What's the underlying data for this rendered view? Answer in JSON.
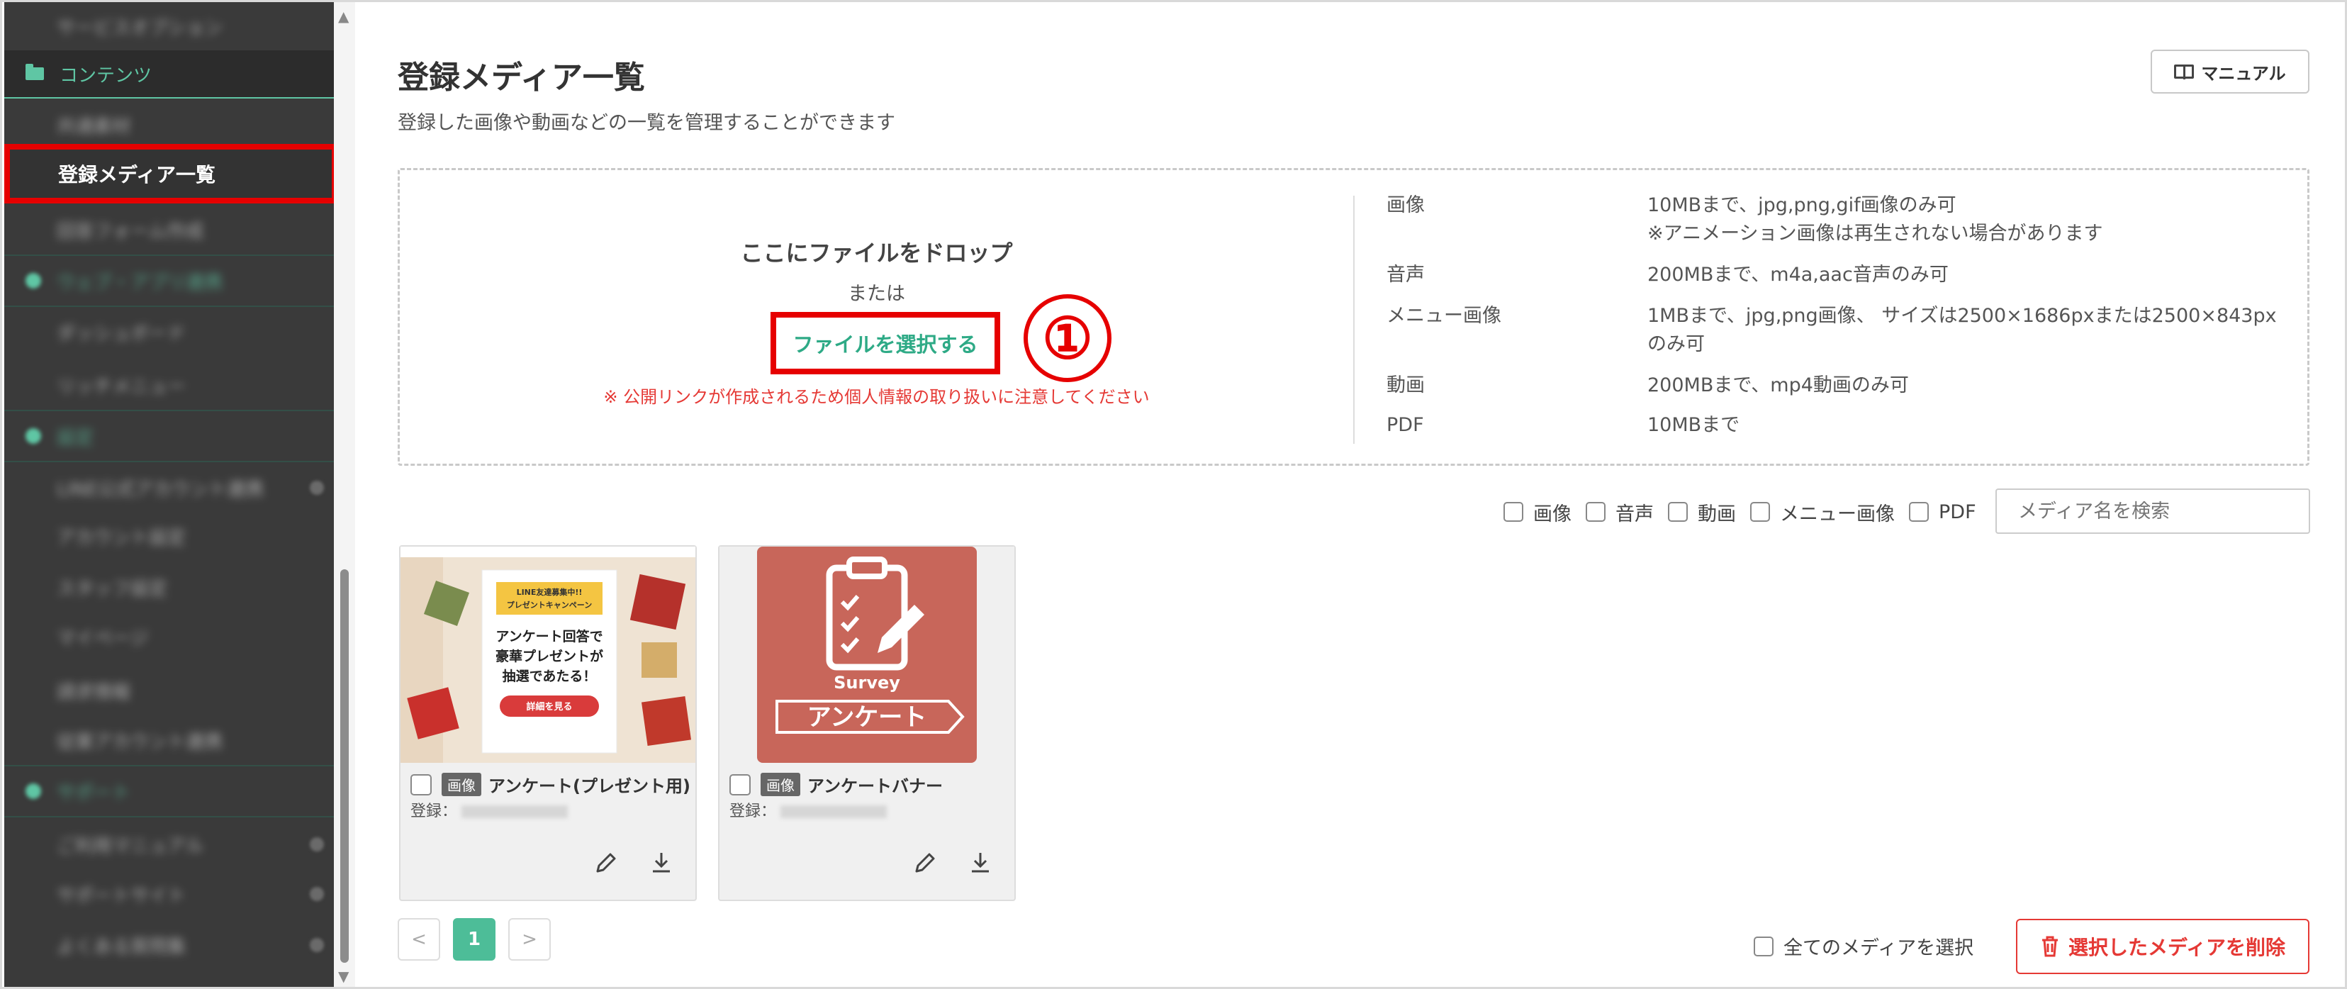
{
  "sidebar": {
    "items_top": [
      "サービスオプション"
    ],
    "contents_section": "コンテンツ",
    "items": [
      "共通素材",
      "登録メディア一覧",
      "回答フォーム作成",
      "ウェブ・アプリ連携",
      "ダッシュボード",
      "リッチメニュー",
      "設定",
      "LINE公式アカウント連携",
      "アカウント設定",
      "スタッフ設定",
      "マイページ",
      "請求情報",
      "従業アカウント連携",
      "サポート",
      "ご利用マニュアル",
      "サポートサイト",
      "よくある質問集"
    ],
    "active_item": "登録メディア一覧"
  },
  "header": {
    "title": "登録メディア一覧",
    "subtitle": "登録した画像や動画などの一覧を管理することができます",
    "manual_button": "マニュアル"
  },
  "dropzone": {
    "title": "ここにファイルをドロップ",
    "or": "または",
    "select_button": "ファイルを選択する",
    "step_marker": "①",
    "warning": "※ 公開リンクが作成されるため個人情報の取り扱いに注意してください",
    "specs": [
      {
        "type": "画像",
        "desc": "10MBまで、jpg,png,gif画像のみ可",
        "note": "※アニメーション画像は再生されない場合があります"
      },
      {
        "type": "音声",
        "desc": "200MBまで、m4a,aac音声のみ可",
        "note": ""
      },
      {
        "type": "メニュー画像",
        "desc": "1MBまで、jpg,png画像、 サイズは2500×1686pxまたは2500×843px",
        "note": "のみ可"
      },
      {
        "type": "動画",
        "desc": "200MBまで、mp4動画のみ可",
        "note": ""
      },
      {
        "type": "PDF",
        "desc": "10MBまで",
        "note": ""
      }
    ]
  },
  "filters": {
    "options": [
      "画像",
      "音声",
      "動画",
      "メニュー画像",
      "PDF"
    ],
    "search_placeholder": "メディア名を検索"
  },
  "media": [
    {
      "badge": "画像",
      "name": "アンケート(プレゼント用)",
      "registered_label": "登録：",
      "thumb": {
        "banner_small": "LINE友達募集中!!",
        "banner_small2": "プレゼントキャンペーン",
        "line1": "アンケート回答で",
        "line2": "豪華プレゼントが",
        "line3": "抽選であたる！",
        "button": "詳細を見る"
      }
    },
    {
      "badge": "画像",
      "name": "アンケートバナー",
      "registered_label": "登録：",
      "thumb": {
        "survey_en": "Survey",
        "survey_jp": "アンケート"
      }
    }
  ],
  "pager": {
    "prev": "<",
    "current": "1",
    "next": ">"
  },
  "footer": {
    "select_all": "全てのメディアを選択",
    "delete_button": "選択したメディアを削除"
  },
  "colors": {
    "accent": "#4dbd98",
    "danger": "#e53935",
    "highlight": "#e60000",
    "sidebar_bg": "#3a3a3a",
    "survey_bg": "#c8665a"
  }
}
